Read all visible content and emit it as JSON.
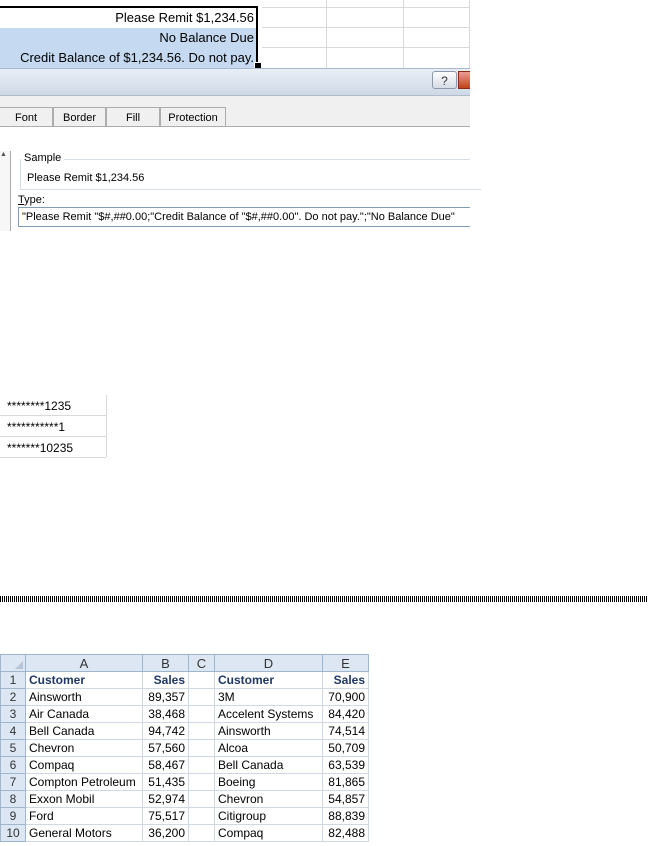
{
  "format_cells_preview": {
    "cells": [
      "Please Remit $1,234.56",
      "No Balance Due",
      "Credit Balance of $1,234.56. Do not pay."
    ]
  },
  "dialog": {
    "help_label": "?",
    "tabs": [
      "Font",
      "Border",
      "Fill",
      "Protection"
    ],
    "sample_label": "Sample",
    "sample_value": "Please Remit $1,234.56",
    "type_label_key": "T",
    "type_label_rest": "ype:",
    "type_value": "\"Please Remit \"$#,##0.00;\"Credit Balance of \"$#,##0.00\". Do not pay.\";\"No Balance Due\""
  },
  "asterisk_cells": [
    "********1235",
    "***********1",
    "*******10235"
  ],
  "sheet": {
    "columns": [
      "A",
      "B",
      "C",
      "D",
      "E"
    ],
    "rows": [
      {
        "n": "1",
        "a": "Customer",
        "b": "Sales",
        "c": "",
        "d": "Customer",
        "e": "Sales"
      },
      {
        "n": "2",
        "a": "Ainsworth",
        "b": "89,357",
        "c": "",
        "d": "3M",
        "e": "70,900"
      },
      {
        "n": "3",
        "a": "Air Canada",
        "b": "38,468",
        "c": "",
        "d": "Accelent Systems",
        "e": "84,420"
      },
      {
        "n": "4",
        "a": "Bell Canada",
        "b": "94,742",
        "c": "",
        "d": "Ainsworth",
        "e": "74,514"
      },
      {
        "n": "5",
        "a": "Chevron",
        "b": "57,560",
        "c": "",
        "d": "Alcoa",
        "e": "50,709"
      },
      {
        "n": "6",
        "a": "Compaq",
        "b": "58,467",
        "c": "",
        "d": "Bell Canada",
        "e": "63,539"
      },
      {
        "n": "7",
        "a": "Compton Petroleum",
        "b": "51,435",
        "c": "",
        "d": "Boeing",
        "e": "81,865"
      },
      {
        "n": "8",
        "a": "Exxon Mobil",
        "b": "52,974",
        "c": "",
        "d": "Chevron",
        "e": "54,857"
      },
      {
        "n": "9",
        "a": "Ford",
        "b": "75,517",
        "c": "",
        "d": "Citigroup",
        "e": "88,839"
      },
      {
        "n": "10",
        "a": "General Motors",
        "b": "36,200",
        "c": "",
        "d": "Compaq",
        "e": "82,488"
      }
    ]
  }
}
